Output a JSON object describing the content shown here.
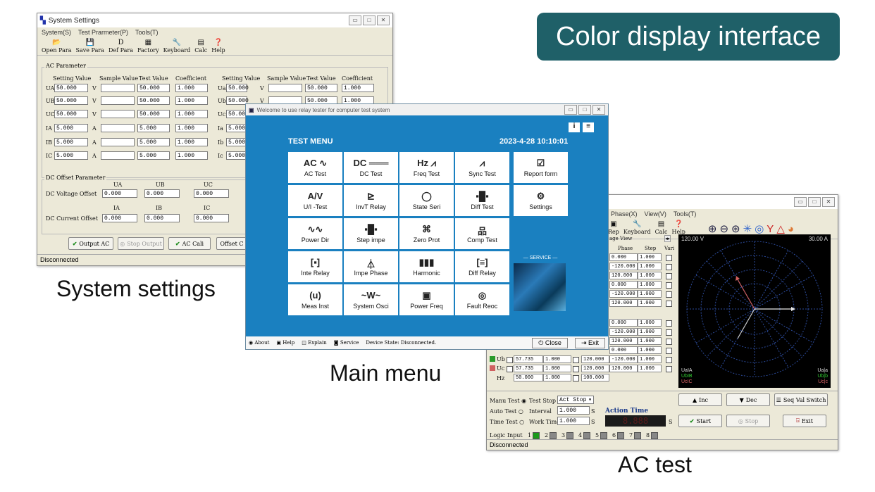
{
  "badge": "Color display interface",
  "captions": {
    "system": "System settings",
    "main": "Main menu",
    "ac": "AC test"
  },
  "sys": {
    "title": "System Settings",
    "menu": [
      "System(S)",
      "Test Prarmeter(P)",
      "Tools(T)"
    ],
    "toolbar": [
      "Open Para",
      "Save Para",
      "Def Para",
      "Factory",
      "Keyboard",
      "Calc",
      "Help"
    ],
    "ac_group": "AC Parameter",
    "headers": [
      "Setting Value",
      "Sample Value",
      "Test Value",
      "Coefficient"
    ],
    "rows": [
      {
        "name": "UA",
        "set": "50.000",
        "unit": "V",
        "test": "50.000",
        "coef": "1.000"
      },
      {
        "name": "UB",
        "set": "50.000",
        "unit": "V",
        "test": "50.000",
        "coef": "1.000"
      },
      {
        "name": "UC",
        "set": "50.000",
        "unit": "V",
        "test": "50.000",
        "coef": "1.000"
      },
      {
        "name": "IA",
        "set": "5.000",
        "unit": "A",
        "test": "5.000",
        "coef": "1.000"
      },
      {
        "name": "IB",
        "set": "5.000",
        "unit": "A",
        "test": "5.000",
        "coef": "1.000"
      },
      {
        "name": "IC",
        "set": "5.000",
        "unit": "A",
        "test": "5.000",
        "coef": "1.000"
      }
    ],
    "rows2": [
      {
        "name": "Ua",
        "set": "50.000",
        "unit": "V",
        "test": "50.000",
        "coef": "1.000"
      },
      {
        "name": "Ub",
        "set": "50.000",
        "unit": "V",
        "test": "50.000",
        "coef": "1.000"
      },
      {
        "name": "Uc",
        "set": "50.000"
      },
      {
        "name": "Ia",
        "set": "5.000"
      },
      {
        "name": "Ib",
        "set": "5.000"
      },
      {
        "name": "Ic",
        "set": "5.000"
      }
    ],
    "dc_group": "DC Offset Parameter",
    "dc_u_headers": [
      "UA",
      "UB",
      "UC"
    ],
    "dc_i_headers": [
      "IA",
      "IB",
      "IC"
    ],
    "dc_voltage_label": "DC Voltage Offset",
    "dc_current_label": "DC Current Offset",
    "dc_values": "0.000",
    "buttons": [
      "Output AC",
      "Stop Output",
      "AC Cali",
      "Offset C"
    ],
    "status": "Disconnected"
  },
  "main": {
    "title": "Welcome to use relay tester for computer test system",
    "header": "TEST MENU",
    "datetime": "2023-4-28 10:10:01",
    "tiles": [
      [
        "AC Test",
        "DC Test",
        "Freq Test",
        "Sync Test",
        "Report form"
      ],
      [
        "U/I -Test",
        "InvT Relay",
        "State Seri",
        "Diff Test",
        "Settings"
      ],
      [
        "Power Dir",
        "Step impe",
        "Zero Prot",
        "Comp Test"
      ],
      [
        "Inte Relay",
        "Impe Phase",
        "Harmonic",
        "Diff Relay"
      ],
      [
        "Meas Inst",
        "System Osci",
        "Power Freq",
        "Fault Reoc"
      ]
    ],
    "tile_icons": [
      [
        "AC ∿",
        "DC ═══",
        "Hz ⩘",
        "⩘",
        "☑"
      ],
      [
        "A/V",
        "⊵",
        "◯",
        "▪█▪",
        "⚙"
      ],
      [
        "∿∿",
        "▪█▪",
        "⌘",
        "品"
      ],
      [
        "[▪]",
        "⏃",
        "▮▮▮",
        "[≡]"
      ],
      [
        "(u)",
        "~W~",
        "▣",
        "◎"
      ]
    ],
    "service": "SERVICE",
    "status_items": [
      "About",
      "Help",
      "Explain",
      "Service",
      "Device State: Disconnected."
    ],
    "close": "Close",
    "exit": "Exit"
  },
  "ac": {
    "menu": [
      "Phase(X)",
      "View(V)",
      "Tools(T)"
    ],
    "toolbar": [
      "Rep",
      "Keyboard",
      "Calc",
      "Help"
    ],
    "tab": "age View",
    "col_headers": [
      "Phase",
      "Step",
      "Vari"
    ],
    "top_rows": [
      {
        "phase": "0.000",
        "step": "1.000"
      },
      {
        "phase": "-120.000",
        "step": "1.000"
      },
      {
        "phase": "120.000",
        "step": "1.000"
      },
      {
        "phase": "0.000",
        "step": "1.000"
      },
      {
        "phase": "-120.000",
        "step": "1.000"
      },
      {
        "phase": "120.000",
        "step": "1.000"
      }
    ],
    "bottom_rows": [
      {
        "phase": "0.000",
        "step": "1.000"
      },
      {
        "phase": "-120.000",
        "step": "1.000"
      },
      {
        "phase": "120.000",
        "step": "1.000"
      },
      {
        "phase": "0.000",
        "step": "1.000"
      }
    ],
    "ub_row": {
      "label": "Ub",
      "amp": "57.735",
      "step": "1.000",
      "phase": "-120.000",
      "pstep": "1.000"
    },
    "uc_row": {
      "label": "Uc",
      "amp": "57.735",
      "step": "1.000",
      "freq": "120.000",
      "phase": "120.000",
      "pstep": "1.000"
    },
    "hz_row": {
      "label": "Hz",
      "amp": "50.000",
      "step": "1.000",
      "freq": "100.000"
    },
    "ub_freq": "120.000",
    "vector": {
      "left": "120.00 V",
      "right": "30.00 A",
      "legend_left": [
        "UaIA",
        "UbIB",
        "UcIC"
      ],
      "legend_right": [
        "Ua|a",
        "Ub|b",
        "Uc|c"
      ]
    },
    "modes": [
      "Manu Test",
      "Auto Test",
      "Time Test"
    ],
    "test_stop": "Test Stop",
    "act_stop": "Act Stop",
    "interval": "Interval",
    "interval_val": "1.000",
    "work_time": "Work Time",
    "work_val": "1.000",
    "unit_s": "S",
    "action_time": "Action Time",
    "btn_inc": "Inc",
    "btn_dec": "Dec",
    "btn_seq": "Seq Val Switch",
    "btn_start": "Start",
    "btn_stop": "Stop",
    "btn_exit": "Exit",
    "logic_label": "Logic Input",
    "logic_inputs": [
      "1",
      "2",
      "3",
      "4",
      "5",
      "6",
      "7",
      "8"
    ],
    "status": "Disconnected"
  }
}
